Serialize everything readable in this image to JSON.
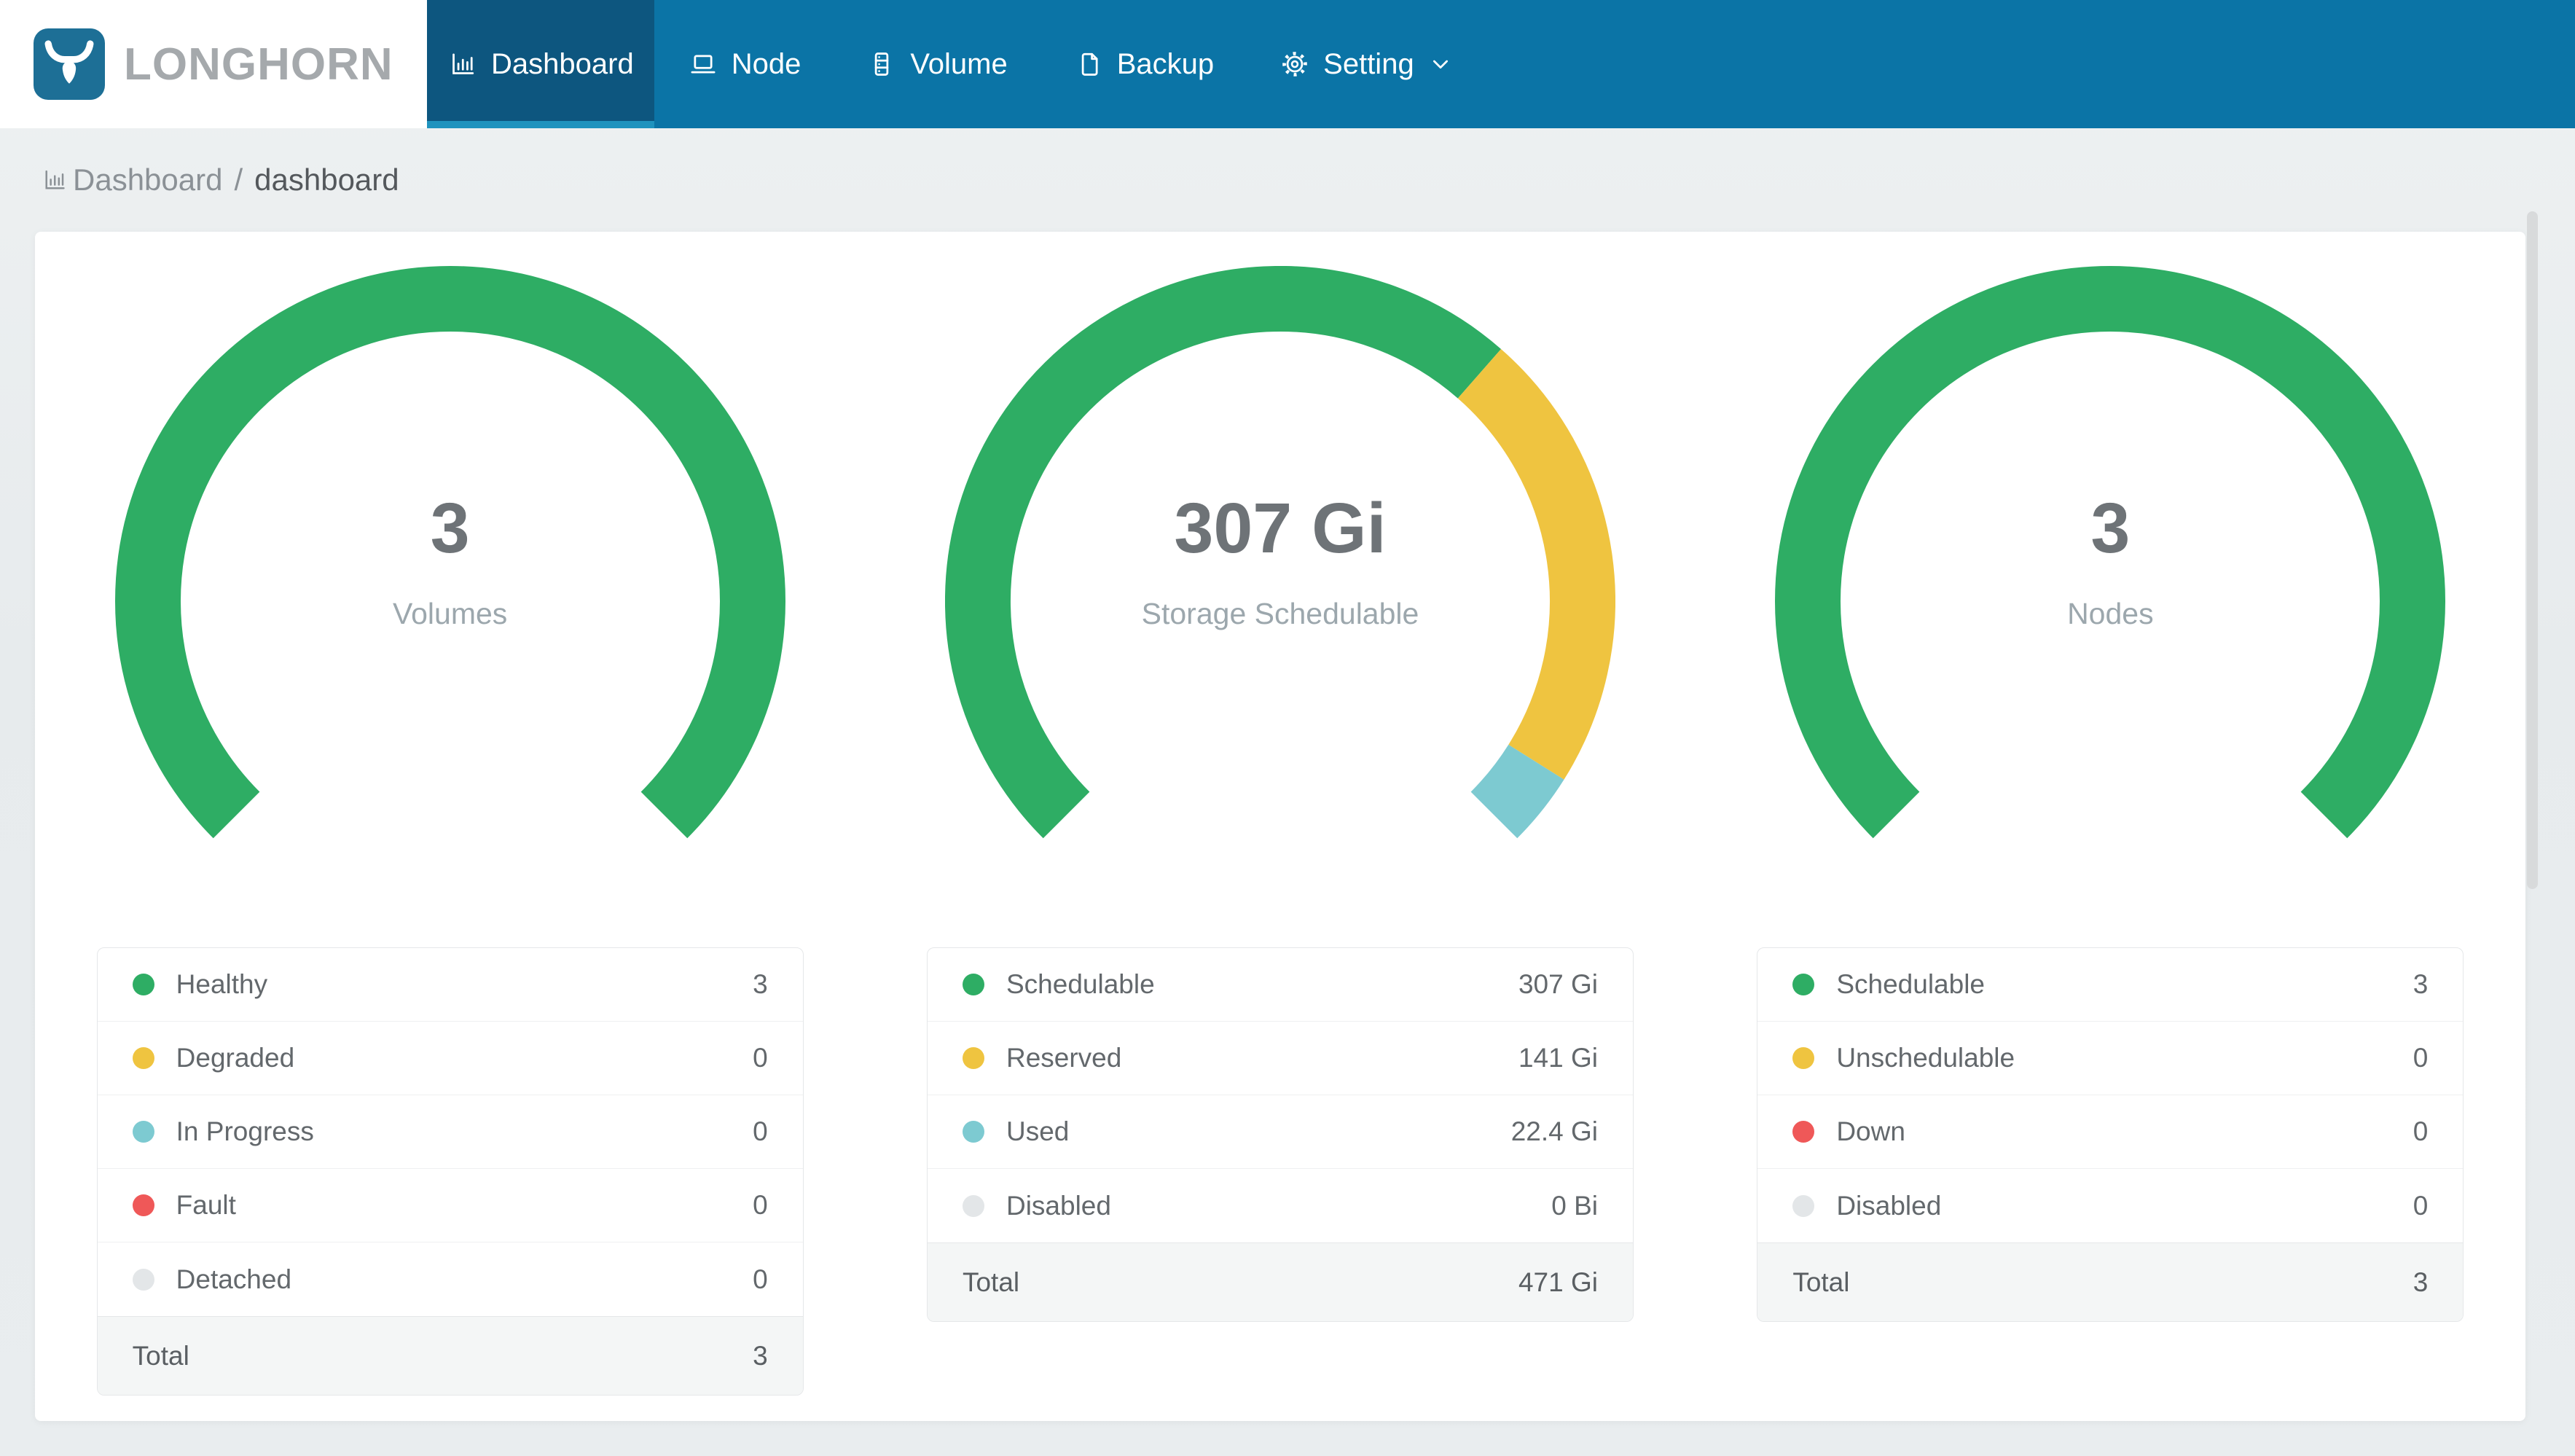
{
  "brand": {
    "name": "LONGHORN",
    "logo_icon": "bull-icon"
  },
  "nav": {
    "items": [
      {
        "label": "Dashboard",
        "icon": "bar-chart",
        "active": true,
        "has_chevron": false
      },
      {
        "label": "Node",
        "icon": "laptop",
        "active": false,
        "has_chevron": false
      },
      {
        "label": "Volume",
        "icon": "server",
        "active": false,
        "has_chevron": false
      },
      {
        "label": "Backup",
        "icon": "document",
        "active": false,
        "has_chevron": false
      },
      {
        "label": "Setting",
        "icon": "gear",
        "active": false,
        "has_chevron": true
      }
    ]
  },
  "breadcrumb": {
    "icon": "bar-chart",
    "section": "Dashboard",
    "separator": "/",
    "page": "dashboard"
  },
  "colors": {
    "green": "#2EAD64",
    "yellow": "#EFC440",
    "teal": "#7DCAD1",
    "red": "#EF5858",
    "gray": "#E3E6E8",
    "nav_bg": "#0B74A6",
    "nav_active_bg": "#0D567F",
    "nav_active_strip": "#1F93BE",
    "logo_blue": "#1D6F96"
  },
  "chart_data": [
    {
      "type": "donut-gauge",
      "id": "volumes",
      "title": "3",
      "subtitle": "Volumes",
      "arc_degrees": 270,
      "segments": [
        {
          "label": "Healthy",
          "value": 3,
          "display": "3",
          "color": "green"
        },
        {
          "label": "Degraded",
          "value": 0,
          "display": "0",
          "color": "yellow"
        },
        {
          "label": "In Progress",
          "value": 0,
          "display": "0",
          "color": "teal"
        },
        {
          "label": "Fault",
          "value": 0,
          "display": "0",
          "color": "red"
        },
        {
          "label": "Detached",
          "value": 0,
          "display": "0",
          "color": "gray"
        }
      ],
      "total": {
        "label": "Total",
        "display": "3"
      }
    },
    {
      "type": "donut-gauge",
      "id": "storage-schedulable",
      "title": "307 Gi",
      "subtitle": "Storage Schedulable",
      "arc_degrees": 270,
      "segments": [
        {
          "label": "Schedulable",
          "value": 307,
          "display": "307 Gi",
          "color": "green"
        },
        {
          "label": "Reserved",
          "value": 141,
          "display": "141 Gi",
          "color": "yellow"
        },
        {
          "label": "Used",
          "value": 22.4,
          "display": "22.4 Gi",
          "color": "teal"
        },
        {
          "label": "Disabled",
          "value": 0,
          "display": "0 Bi",
          "color": "gray"
        }
      ],
      "total": {
        "label": "Total",
        "display": "471 Gi"
      }
    },
    {
      "type": "donut-gauge",
      "id": "nodes",
      "title": "3",
      "subtitle": "Nodes",
      "arc_degrees": 270,
      "segments": [
        {
          "label": "Schedulable",
          "value": 3,
          "display": "3",
          "color": "green"
        },
        {
          "label": "Unschedulable",
          "value": 0,
          "display": "0",
          "color": "yellow"
        },
        {
          "label": "Down",
          "value": 0,
          "display": "0",
          "color": "red"
        },
        {
          "label": "Disabled",
          "value": 0,
          "display": "0",
          "color": "gray"
        }
      ],
      "total": {
        "label": "Total",
        "display": "3"
      }
    }
  ]
}
